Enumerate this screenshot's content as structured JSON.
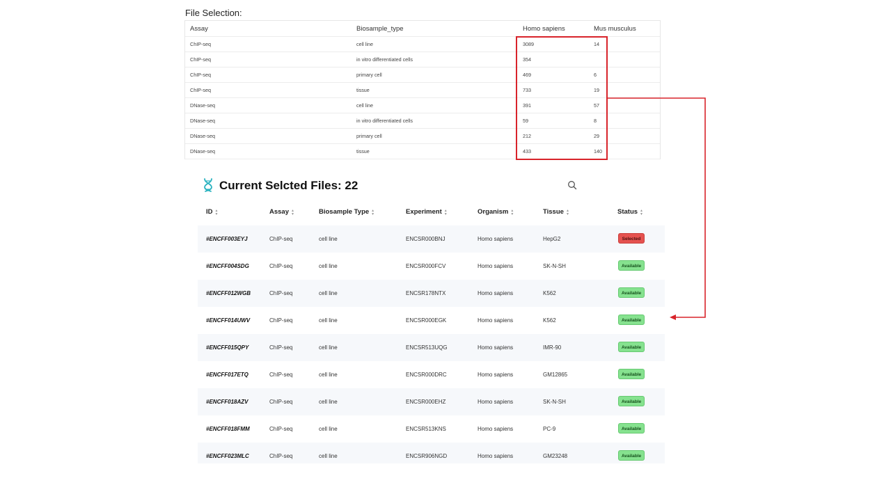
{
  "file_selection": {
    "title": "File Selection:",
    "headers": [
      "Assay",
      "Biosample_type",
      "Homo sapiens",
      "Mus musculus"
    ],
    "rows": [
      [
        "ChIP-seq",
        "cell line",
        "3089",
        "14"
      ],
      [
        "ChIP-seq",
        "in vitro differentiated cells",
        "354",
        ""
      ],
      [
        "ChIP-seq",
        "primary cell",
        "469",
        "6"
      ],
      [
        "ChIP-seq",
        "tissue",
        "733",
        "19"
      ],
      [
        "DNase-seq",
        "cell line",
        "391",
        "57"
      ],
      [
        "DNase-seq",
        "in vitro differentiated cells",
        "59",
        "8"
      ],
      [
        "DNase-seq",
        "primary cell",
        "212",
        "29"
      ],
      [
        "DNase-seq",
        "tissue",
        "433",
        "140"
      ]
    ],
    "highlight_color": "#d8232a"
  },
  "selected_files": {
    "title": "Current Selcted Files: 22",
    "icons": {
      "title": "dna-icon",
      "search": "search-icon",
      "sort": "sort-icon"
    },
    "headers": [
      "ID",
      "Assay",
      "Biosample Type",
      "Experiment",
      "Organism",
      "Tissue",
      "Status"
    ],
    "rows": [
      {
        "id": "#ENCFF003EYJ",
        "assay": "ChIP-seq",
        "biosample": "cell line",
        "experiment": "ENCSR000BNJ",
        "organism": "Homo sapiens",
        "tissue": "HepG2",
        "status": "Selected"
      },
      {
        "id": "#ENCFF004SDG",
        "assay": "ChIP-seq",
        "biosample": "cell line",
        "experiment": "ENCSR000FCV",
        "organism": "Homo sapiens",
        "tissue": "SK-N-SH",
        "status": "Available"
      },
      {
        "id": "#ENCFF012WGB",
        "assay": "ChIP-seq",
        "biosample": "cell line",
        "experiment": "ENCSR178NTX",
        "organism": "Homo sapiens",
        "tissue": "K562",
        "status": "Available"
      },
      {
        "id": "#ENCFF014UWV",
        "assay": "ChIP-seq",
        "biosample": "cell line",
        "experiment": "ENCSR000EGK",
        "organism": "Homo sapiens",
        "tissue": "K562",
        "status": "Available"
      },
      {
        "id": "#ENCFF015QPY",
        "assay": "ChIP-seq",
        "biosample": "cell line",
        "experiment": "ENCSR513UQG",
        "organism": "Homo sapiens",
        "tissue": "IMR-90",
        "status": "Available"
      },
      {
        "id": "#ENCFF017ETQ",
        "assay": "ChIP-seq",
        "biosample": "cell line",
        "experiment": "ENCSR000DRC",
        "organism": "Homo sapiens",
        "tissue": "GM12865",
        "status": "Available"
      },
      {
        "id": "#ENCFF018AZV",
        "assay": "ChIP-seq",
        "biosample": "cell line",
        "experiment": "ENCSR000EHZ",
        "organism": "Homo sapiens",
        "tissue": "SK-N-SH",
        "status": "Available"
      },
      {
        "id": "#ENCFF018FMM",
        "assay": "ChIP-seq",
        "biosample": "cell line",
        "experiment": "ENCSR513KNS",
        "organism": "Homo sapiens",
        "tissue": "PC-9",
        "status": "Available"
      },
      {
        "id": "#ENCFF023MLC",
        "assay": "ChIP-seq",
        "biosample": "cell line",
        "experiment": "ENCSR906NGD",
        "organism": "Homo sapiens",
        "tissue": "GM23248",
        "status": "Available"
      }
    ],
    "colors": {
      "selected": "#e5524f",
      "available": "#86e28f",
      "icon": "#2bb3c0"
    }
  }
}
